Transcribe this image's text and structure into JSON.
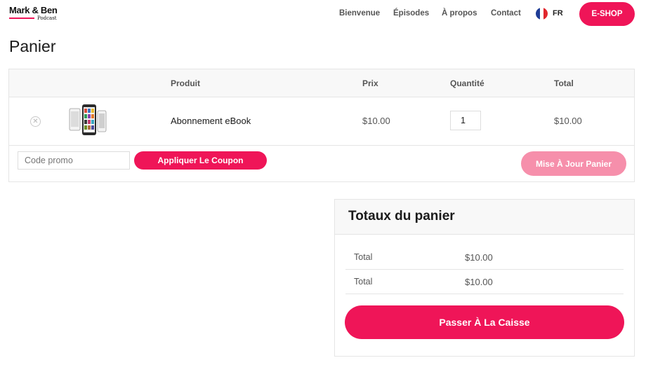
{
  "brand": {
    "name": "Mark & Ben",
    "sub": "Podcast",
    "accent": "#ef1558"
  },
  "nav": {
    "items": [
      "Bienvenue",
      "Épisodes",
      "À propos",
      "Contact"
    ],
    "language": "FR",
    "shop_label": "E-SHOP"
  },
  "page": {
    "title": "Panier"
  },
  "cart": {
    "columns": {
      "product": "Produit",
      "price": "Prix",
      "quantity": "Quantité",
      "total": "Total"
    },
    "items": [
      {
        "name": "Abonnement eBook",
        "price": "$10.00",
        "quantity": "1",
        "total": "$10.00",
        "remove_icon": "remove-circle-icon"
      }
    ],
    "promo_placeholder": "Code promo",
    "apply_coupon_label": "Appliquer Le Coupon",
    "update_cart_label": "Mise À Jour Panier"
  },
  "totals": {
    "title": "Totaux du panier",
    "rows": [
      {
        "label": "Total",
        "value": "$10.00"
      },
      {
        "label": "Total",
        "value": "$10.00"
      }
    ],
    "checkout_label": "Passer À La Caisse"
  }
}
